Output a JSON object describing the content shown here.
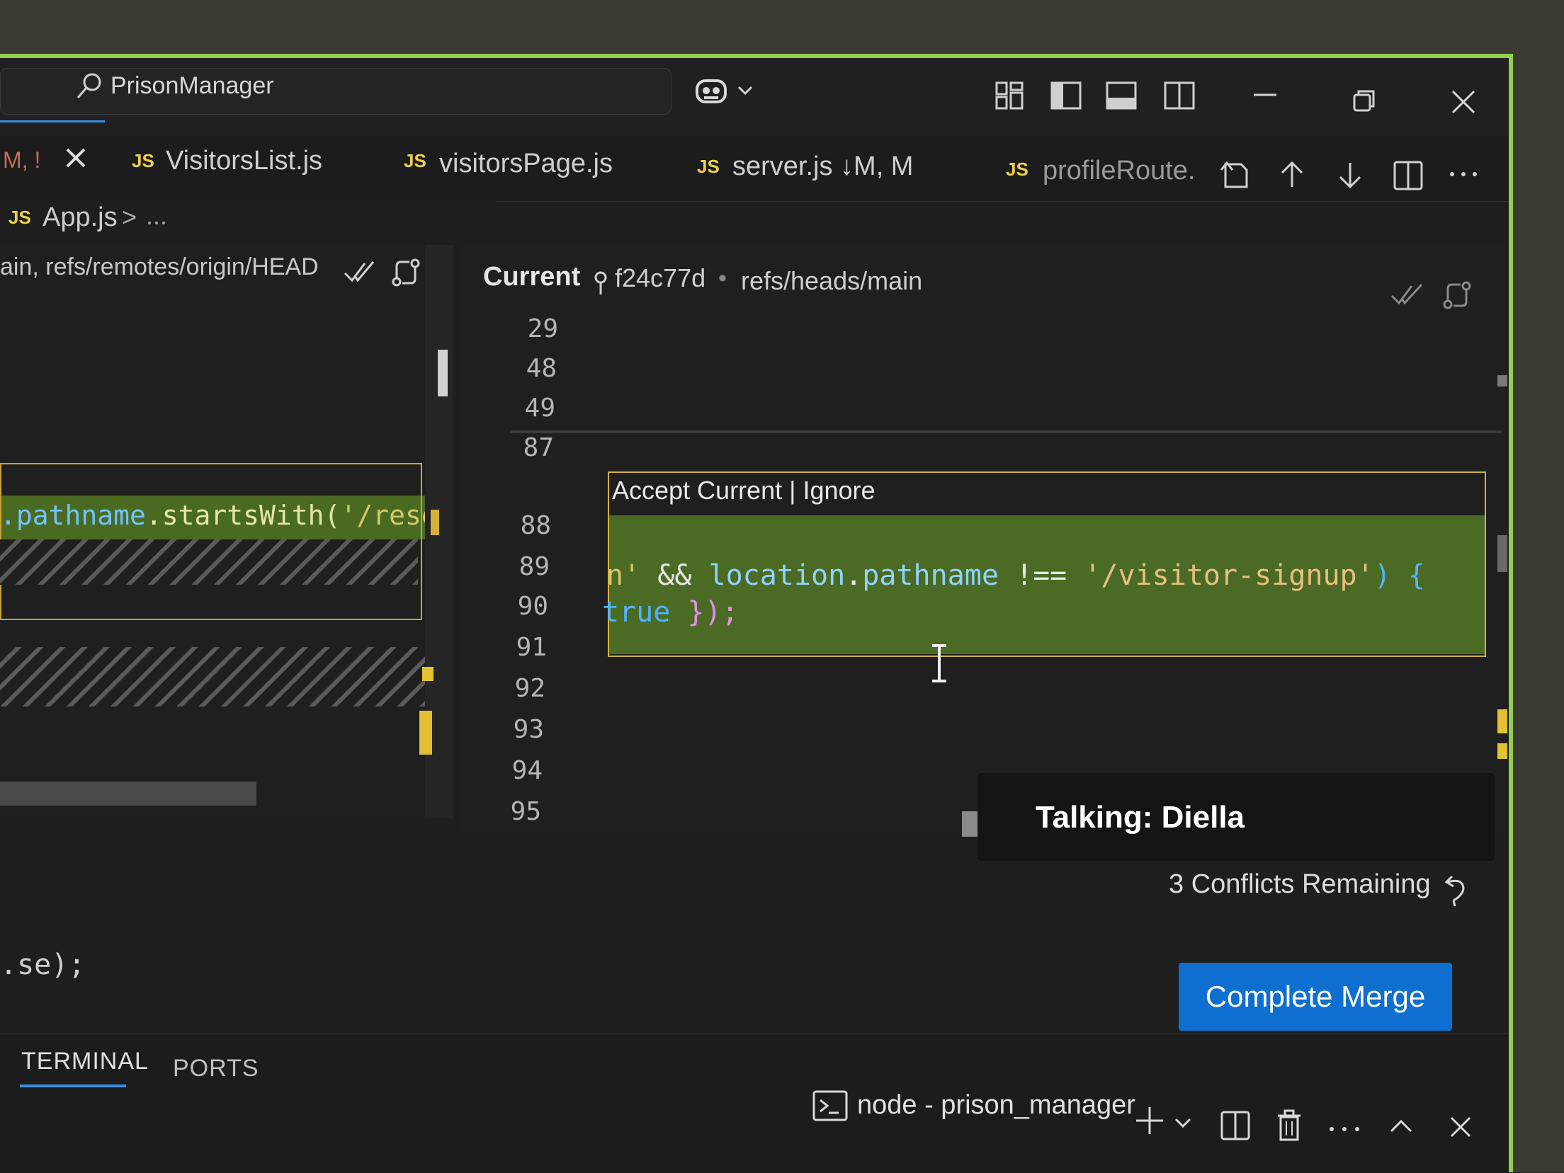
{
  "window": {
    "search_label": "PrisonManager"
  },
  "tabs": [
    {
      "status": "M, !",
      "label": ""
    },
    {
      "badge": "JS",
      "label": "VisitorsList.js"
    },
    {
      "badge": "JS",
      "label": "visitorsPage.js"
    },
    {
      "badge": "JS",
      "label": "server.js ↓M, M"
    },
    {
      "badge": "JS",
      "label": "profileRoute."
    }
  ],
  "breadcrumb": {
    "badge": "JS",
    "file": "App.js",
    "separator": ">",
    "more": "..."
  },
  "left_pane": {
    "header": "ain, refs/remotes/origin/HEAD",
    "code": {
      "part1": ".pathname",
      "part2": ".startsWith(",
      "part3": "'/rese"
    },
    "bottom_code": ".se);"
  },
  "right_pane": {
    "title": "Current",
    "commit_hash": "f24c77d",
    "dot": "•",
    "ref": "refs/heads/main",
    "line_numbers": [
      "29",
      "48",
      "49",
      "87",
      "88",
      "89",
      "90",
      "91",
      "92",
      "93",
      "94",
      "95"
    ],
    "codelens": "Accept Current | Ignore",
    "code_line_1": {
      "a": "n'",
      "b": " && ",
      "c": "location",
      "d": ".",
      "e": "pathname",
      "f": " !== ",
      "g": "'/visitor-signup'",
      "h": ") {"
    },
    "code_line_2": {
      "a": "true",
      "b": " });"
    }
  },
  "overlay": {
    "talking": "Talking: Diella"
  },
  "merge": {
    "conflicts_remaining": "3 Conflicts Remaining",
    "complete_button": "Complete Merge"
  },
  "panel": {
    "tab_terminal": "TERMINAL",
    "tab_ports": "PORTS",
    "terminal_name": "node - prison_manager"
  },
  "colors": {
    "accent_border": "#8fd14f",
    "conflict_border": "#d4b23c",
    "button_blue": "#0e6fd1",
    "js_badge": "#e9d04f",
    "string_yellow": "#d4c76a",
    "keyword_blue": "#4fb3ff"
  }
}
